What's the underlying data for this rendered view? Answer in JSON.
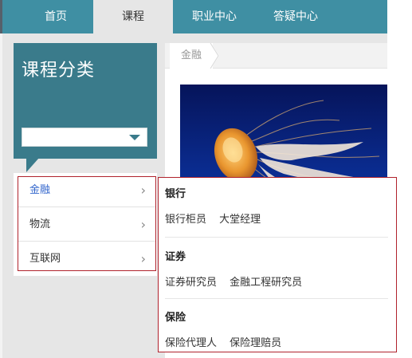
{
  "nav": {
    "tabs": [
      {
        "label": "首页",
        "active": false
      },
      {
        "label": "课程",
        "active": true
      },
      {
        "label": "职业中心",
        "active": false
      },
      {
        "label": "答疑中心",
        "active": false
      }
    ]
  },
  "sidebar": {
    "title": "课程分类",
    "select_value": "",
    "items": [
      {
        "label": "金融",
        "active": true
      },
      {
        "label": "物流",
        "active": false
      },
      {
        "label": "互联网",
        "active": false
      }
    ]
  },
  "main": {
    "breadcrumb": "金融",
    "banner_icon": "jellyfish-image"
  },
  "dropdown": {
    "groups": [
      {
        "title": "银行",
        "links": [
          "银行柜员",
          "大堂经理"
        ]
      },
      {
        "title": "证券",
        "links": [
          "证券研究员",
          "金融工程研究员"
        ]
      },
      {
        "title": "保险",
        "links": [
          "保险代理人",
          "保险理赔员"
        ]
      }
    ]
  },
  "colors": {
    "nav_bg": "#3f8fa3",
    "sidebar_bg": "#3a7b8b",
    "active_link": "#3366cc",
    "highlight_border": "#b0222c"
  }
}
